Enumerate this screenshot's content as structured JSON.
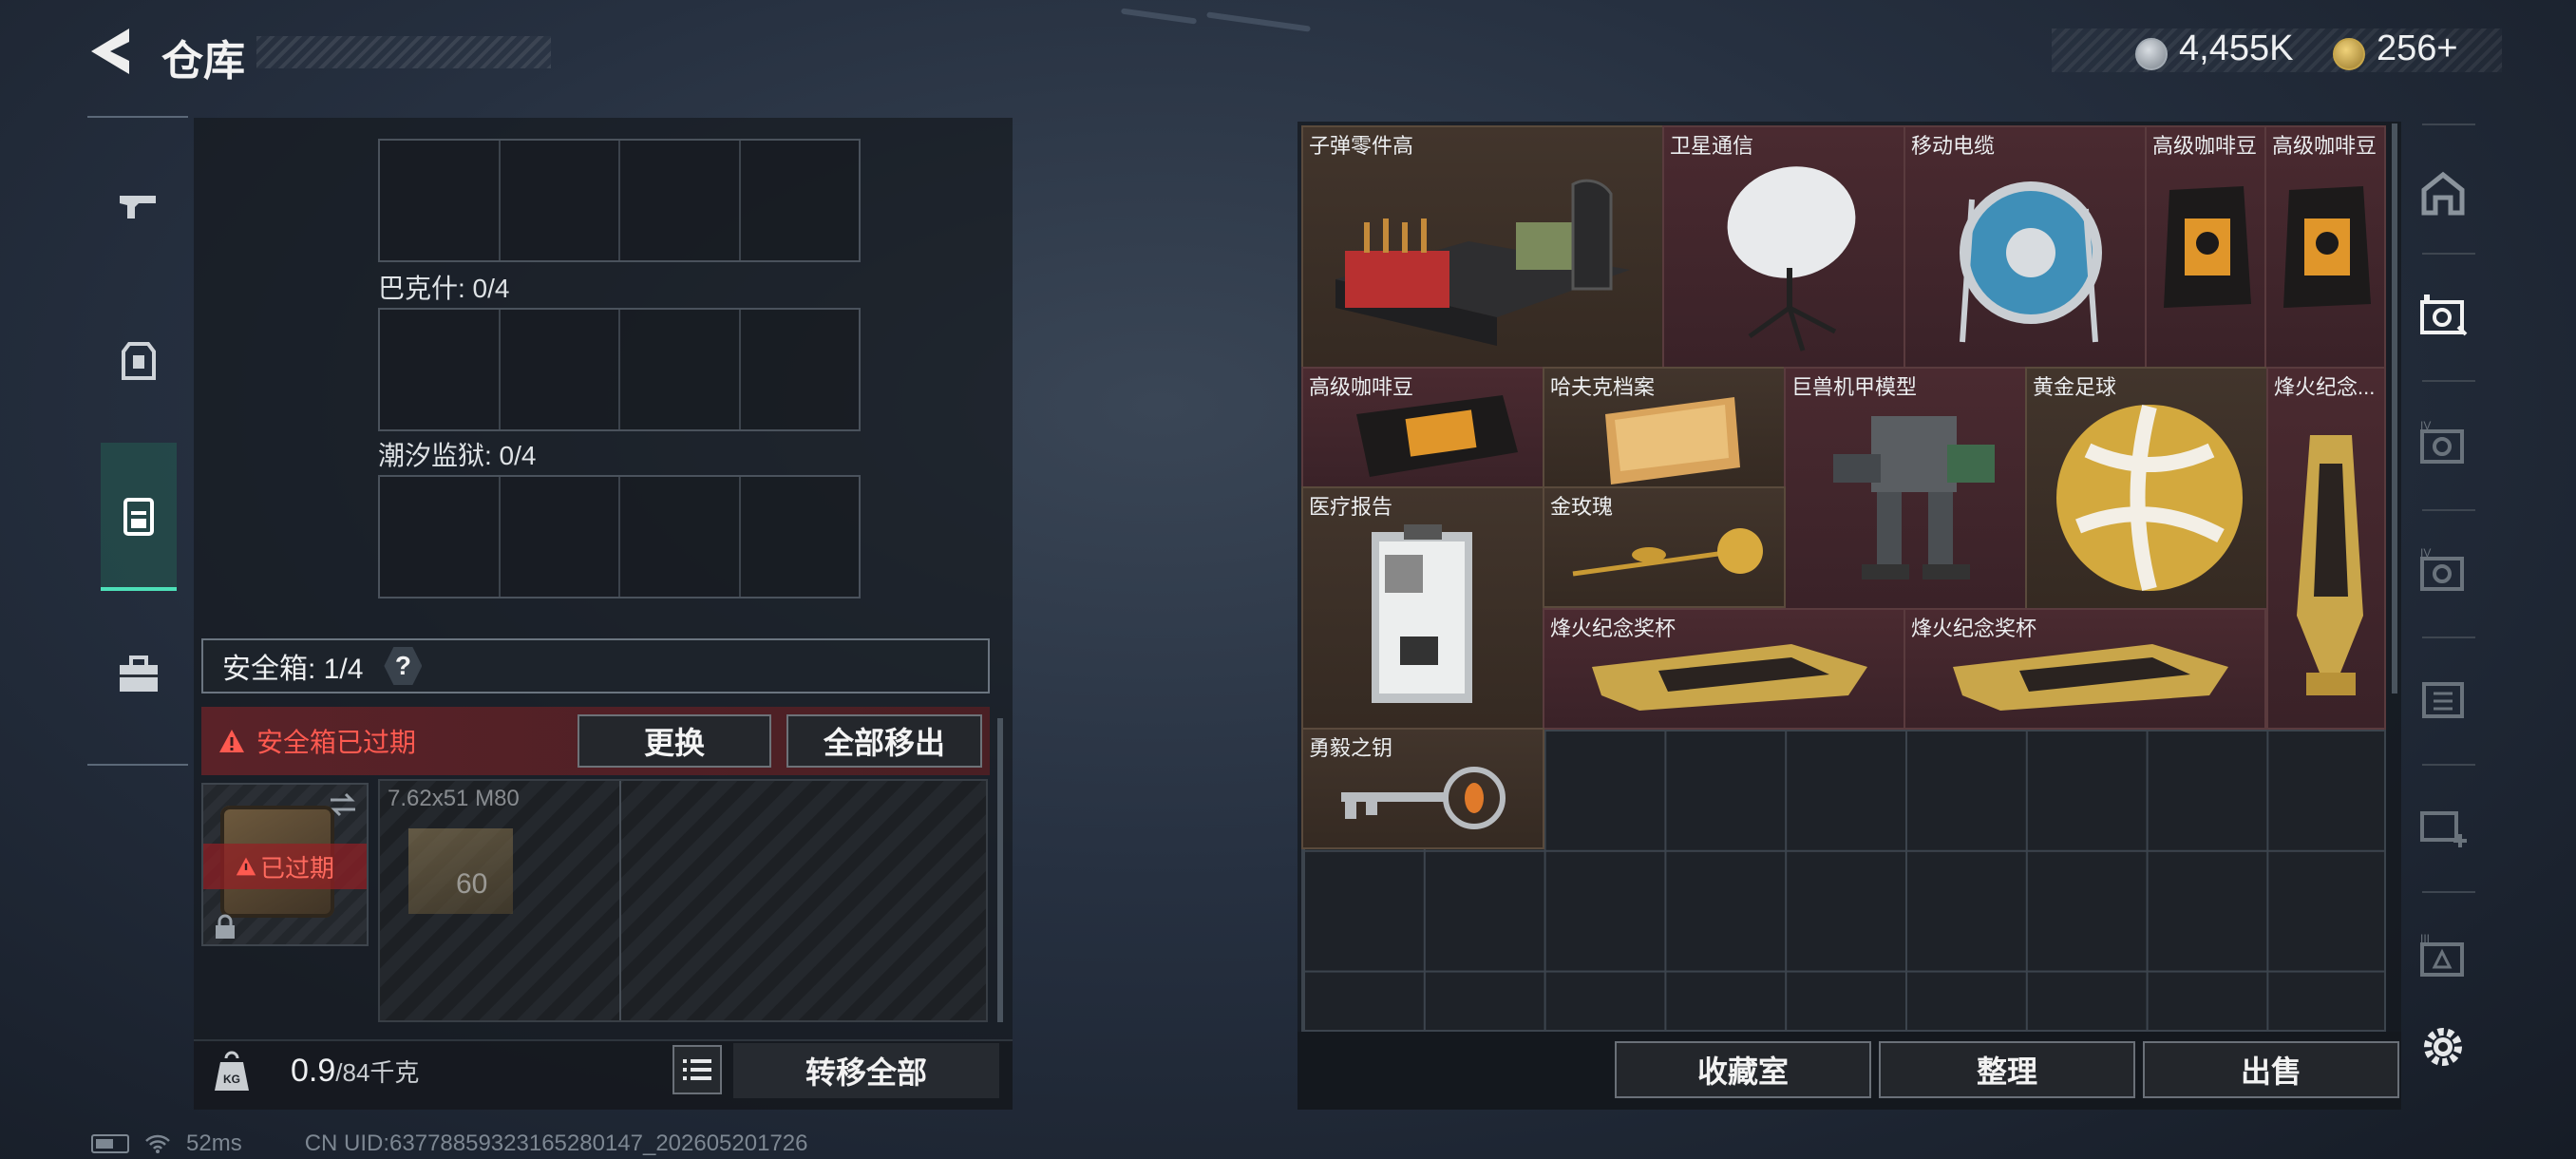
{
  "header": {
    "title": "仓库"
  },
  "currency": [
    {
      "value": "4,455K",
      "icon": "silver-coin-icon"
    },
    {
      "value": "256+",
      "icon": "gold-coin-icon"
    }
  ],
  "left": {
    "slot_labels": [
      "巴克什: 0/4",
      "潮汐监狱: 0/4"
    ],
    "safebox": {
      "label": "安全箱: 1/4",
      "help": "?"
    },
    "expired": {
      "message": "安全箱已过期",
      "replace": "更换",
      "move_all": "全部移出"
    },
    "box_overlay": "已过期",
    "ammo": {
      "name": "7.62x51 M80",
      "count": "60"
    },
    "weight": {
      "current": "0.9",
      "max": "/84千克"
    },
    "transfer_all": "转移全部"
  },
  "status": {
    "ping": "52ms",
    "uid": "CN UID:6377885932316528014​7_202605201726"
  },
  "items": [
    {
      "name": "子弹零件高",
      "style": "brown"
    },
    {
      "name": "卫星通信",
      "style": "red"
    },
    {
      "name": "移动电缆",
      "style": "red"
    },
    {
      "name": "高级咖啡豆",
      "style": "red"
    },
    {
      "name": "高级咖啡豆",
      "style": "red"
    },
    {
      "name": "高级咖啡豆",
      "style": "red"
    },
    {
      "name": "哈夫克档案",
      "style": "brown"
    },
    {
      "name": "巨兽机甲模型",
      "style": "red"
    },
    {
      "name": "黄金足球",
      "style": "brown"
    },
    {
      "name": "烽火纪念...",
      "style": "red"
    },
    {
      "name": "医疗报告",
      "style": "brown"
    },
    {
      "name": "金玫瑰",
      "style": "brown"
    },
    {
      "name": "烽火纪念奖杯",
      "style": "red"
    },
    {
      "name": "烽火纪念奖杯",
      "style": "red"
    },
    {
      "name": "勇毅之钥",
      "style": "brown"
    }
  ],
  "actions": {
    "collection": "收藏室",
    "organize": "整理",
    "sell": "出售"
  },
  "colors": {
    "accent": "#4de0b8",
    "warning": "#ff5a50",
    "rare_bg": "#4a2a30"
  }
}
